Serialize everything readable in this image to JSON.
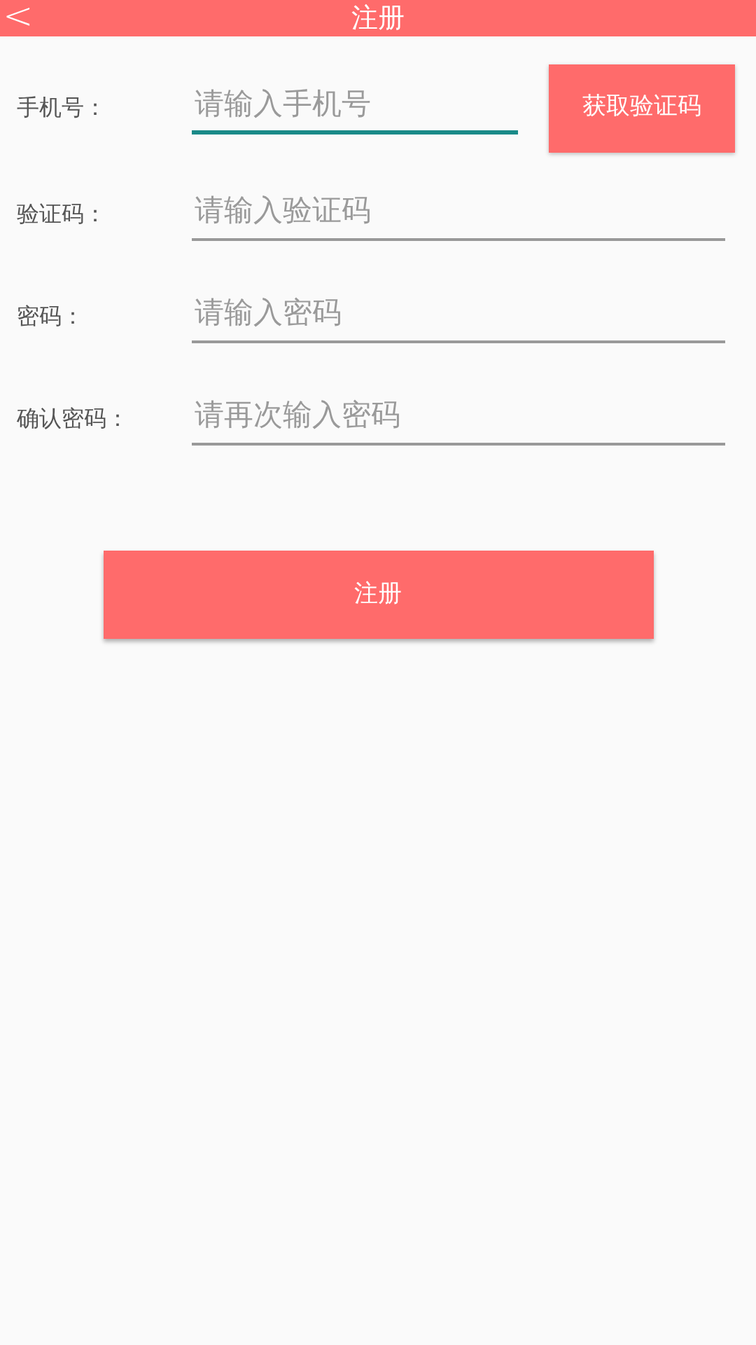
{
  "header": {
    "back": "<",
    "title": "注册"
  },
  "fields": [
    {
      "label": "手机号：",
      "placeholder": "请输入手机号",
      "focused": true,
      "action": "获取验证码"
    },
    {
      "label": "验证码：",
      "placeholder": "请输入验证码",
      "focused": false
    },
    {
      "label": "密码：",
      "placeholder": "请输入密码",
      "focused": false
    },
    {
      "label": "确认密码：",
      "placeholder": "请再次输入密码",
      "focused": false
    }
  ],
  "submit": "注册"
}
